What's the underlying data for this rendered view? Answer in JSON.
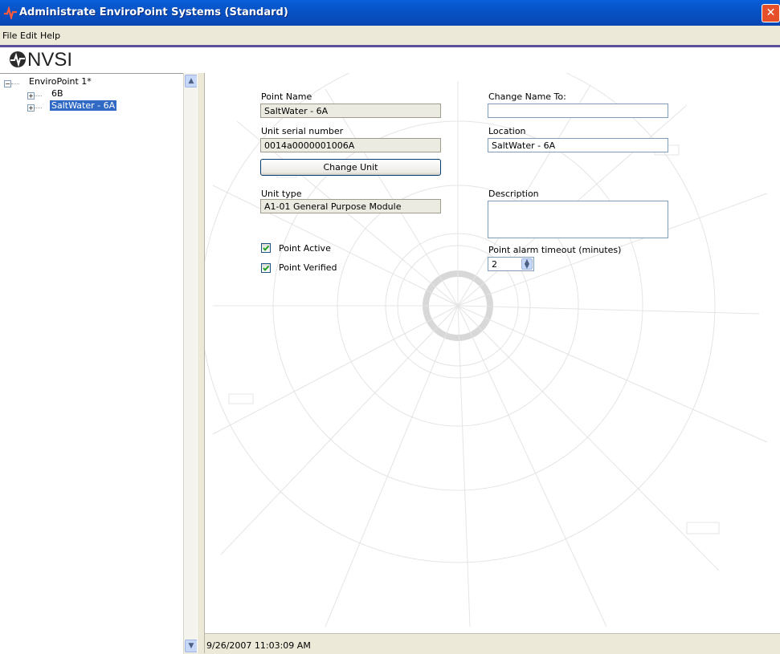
{
  "window": {
    "title": "Administrate EnviroPoint Systems (Standard)",
    "close_glyph": "✕"
  },
  "menu": {
    "items": [
      "File",
      "Edit",
      "Help"
    ]
  },
  "logo": {
    "text": "NVSI",
    "icon": "nvsi-logo-icon"
  },
  "tree": {
    "root": "EnviroPoint 1*",
    "children": [
      "6B",
      "SaltWater - 6A"
    ],
    "selected_index": 1
  },
  "form": {
    "point_name_label": "Point Name",
    "point_name_value": "SaltWater - 6A",
    "serial_label": "Unit serial number",
    "serial_value": "0014a0000001006A",
    "change_unit_button": "Change Unit",
    "unit_type_label": "Unit type",
    "unit_type_value": "A1-01 General Purpose Module",
    "point_active_label": "Point Active",
    "point_active_checked": true,
    "point_verified_label": "Point Verified",
    "point_verified_checked": true,
    "change_name_label": "Change Name To:",
    "change_name_value": "",
    "location_label": "Location",
    "location_value": "SaltWater - 6A",
    "description_label": "Description",
    "description_value": "",
    "alarm_timeout_label": "Point alarm timeout (minutes)",
    "alarm_timeout_value": "2"
  },
  "status": {
    "timestamp": "9/26/2007 11:03:09 AM"
  },
  "colors": {
    "titlebar": "#0753c6",
    "selection": "#316ac5",
    "menu_rule": "#5a4f9a"
  }
}
